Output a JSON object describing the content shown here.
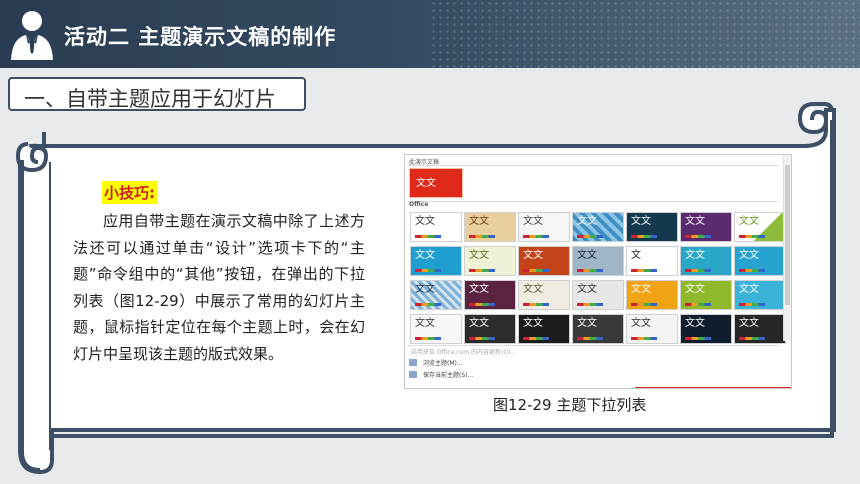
{
  "header": {
    "title": "活动二  主题演示文稿的制作",
    "icon": "businessman-icon"
  },
  "section": {
    "title": "一、自带主题应用于幻灯片"
  },
  "tip": {
    "label": "小技巧:",
    "paragraph": "应用自带主题在演示文稿中除了上述方法还可以通过单击“设计”选项卡下的“主题”命令组中的“其他”按钮，在弹出的下拉列表（图12-29）中展示了常用的幻灯片主题，鼠标指针定位在每个主题上时，会在幻灯片中呈现该主题的版式效果。"
  },
  "screenshot": {
    "current_header": "此演示文稿",
    "current_theme_text": "文文",
    "office_header": "Office",
    "theme_text": "文文",
    "theme_text_single": "文",
    "link_enable": "启用来自 Office.com 的内容更新(O)...",
    "link_browse": "浏览主题(M)...",
    "link_save": "保存当前主题(S)..."
  },
  "caption": "图12-29  主题下拉列表",
  "colors": {
    "header_bg": "#2a3c52",
    "accent_red": "#d11d1d",
    "highlight": "#ffff00",
    "frame": "#3d4f66"
  }
}
